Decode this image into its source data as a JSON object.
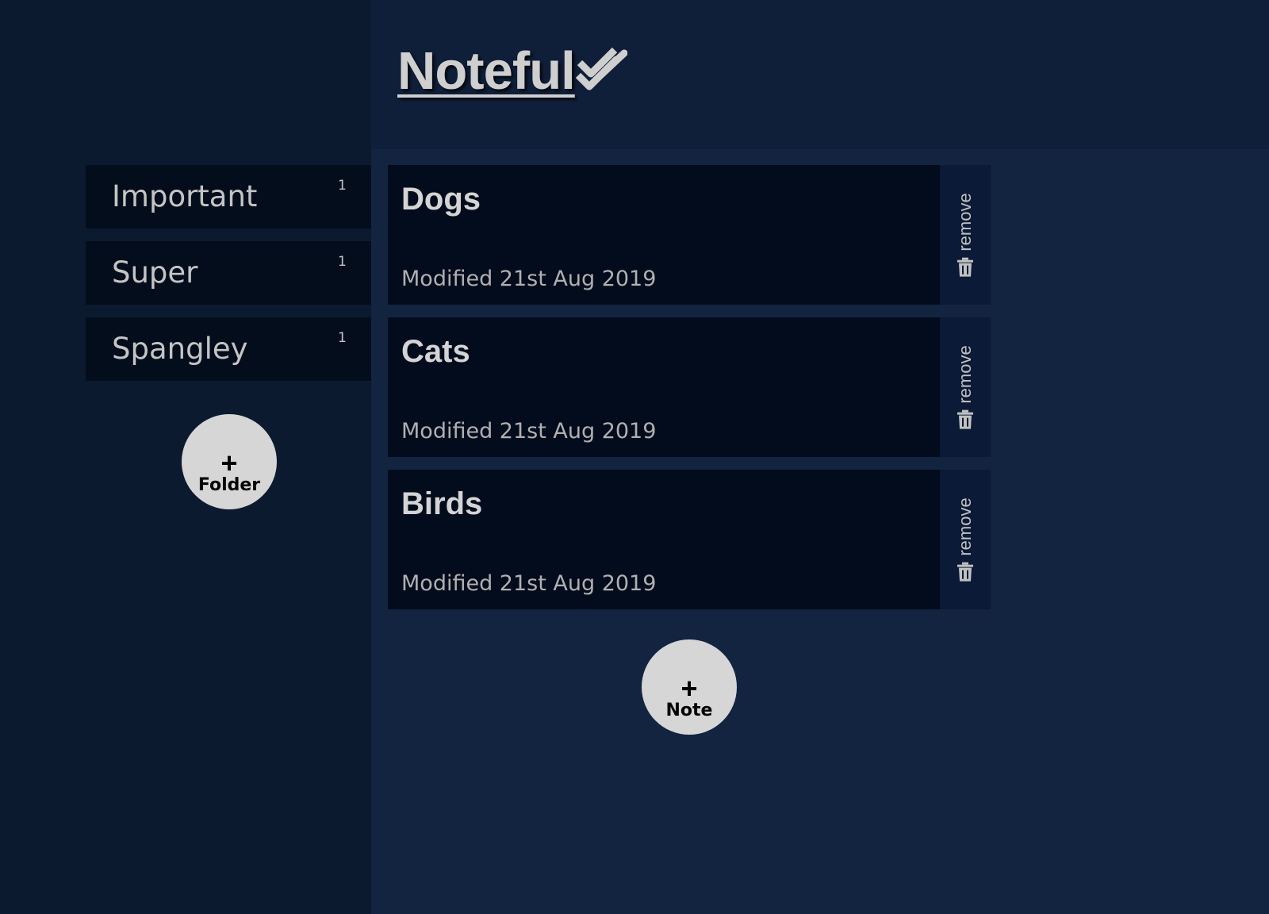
{
  "app": {
    "title": "Noteful",
    "title_icon": "double-check-icon"
  },
  "sidebar": {
    "folders": [
      {
        "name": "Important",
        "count": "1"
      },
      {
        "name": "Super",
        "count": "1"
      },
      {
        "name": "Spangley",
        "count": "1"
      }
    ],
    "add_folder": {
      "icon": "+",
      "label": "Folder"
    }
  },
  "main": {
    "notes": [
      {
        "title": "Dogs",
        "modified": "Modified 21st Aug 2019",
        "remove_label": "remove"
      },
      {
        "title": "Cats",
        "modified": "Modified 21st Aug 2019",
        "remove_label": "remove"
      },
      {
        "title": "Birds",
        "modified": "Modified 21st Aug 2019",
        "remove_label": "remove"
      }
    ],
    "add_note": {
      "icon": "+",
      "label": "Note"
    }
  },
  "colors": {
    "sidebar_bg": "#0c1a30",
    "header_bg": "#0f1f39",
    "main_bg": "#132440",
    "item_bg": "#040d1c",
    "button_bg": "#d6d6d6",
    "text": "#c4c4c4"
  }
}
